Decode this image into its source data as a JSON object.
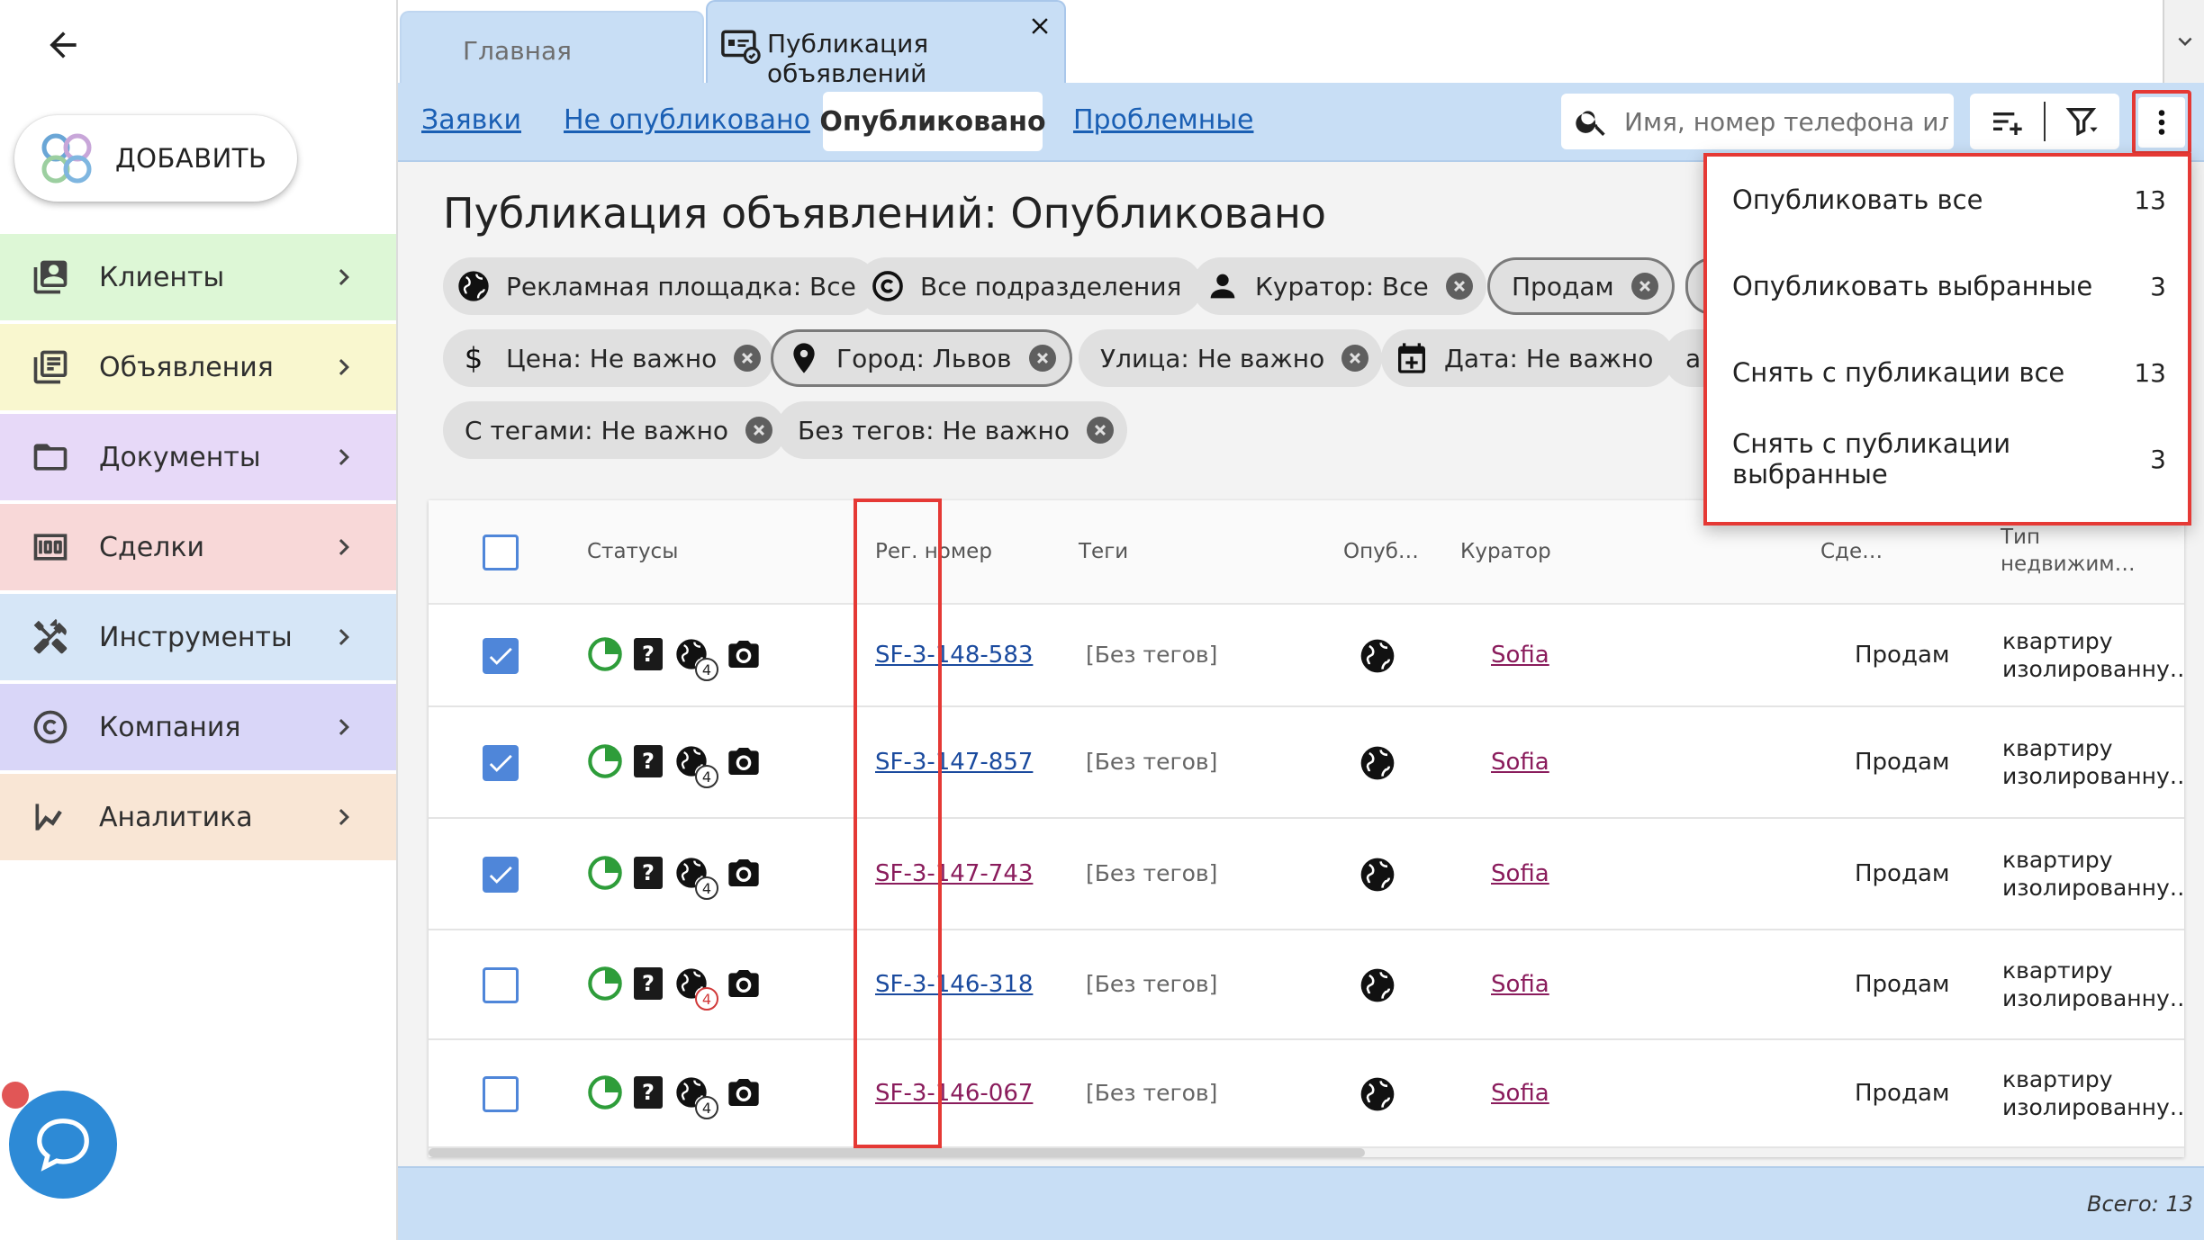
{
  "sidebar": {
    "add_label": "ДОБАВИТЬ",
    "items": [
      {
        "label": "Клиенты",
        "color": "#ddf7d6"
      },
      {
        "label": "Объявления",
        "color": "#f9f7cf"
      },
      {
        "label": "Документы",
        "color": "#e7d9f8"
      },
      {
        "label": "Сделки",
        "color": "#f8d8d8"
      },
      {
        "label": "Инструменты",
        "color": "#d6e6f7"
      },
      {
        "label": "Компания",
        "color": "#d9d6f8"
      },
      {
        "label": "Аналитика",
        "color": "#f9e6d5"
      }
    ]
  },
  "tabs": {
    "home": "Главная",
    "active": "Публикация объявлений"
  },
  "subnav": {
    "requests": "Заявки",
    "not_published": "Не опубликовано",
    "published": "Опубликовано",
    "problematic": "Проблемные"
  },
  "search": {
    "placeholder": "Имя, номер телефона или id"
  },
  "page_title": "Публикация объявлений: Опубликовано",
  "filters": {
    "platform": "Рекламная площадка: Все",
    "divisions": "Все подразделения",
    "curator": "Куратор: Все",
    "sell": "Продам",
    "price": "Цена: Не важно",
    "city": "Город: Львов",
    "street": "Улица: Не важно",
    "date": "Дата: Не важно",
    "partial": "a",
    "with_tags": "С тегами: Не важно",
    "without_tags": "Без тегов: Не важно"
  },
  "table": {
    "headers": {
      "statuses": "Статусы",
      "reg_number": "Рег. номер",
      "tags": "Теги",
      "published": "Опуб…",
      "curator": "Куратор",
      "deal": "Сде…",
      "type_line1": "Тип",
      "type_line2": "недвижим…"
    },
    "rows": [
      {
        "checked": true,
        "reg": "SF-3-148-583",
        "tags": "[Без тегов]",
        "curator": "Sofia",
        "deal": "Продам",
        "type1": "квартиру",
        "type2": "изолированну…",
        "badge": "4",
        "badge_red": false,
        "reg_color": "blue"
      },
      {
        "checked": true,
        "reg": "SF-3-147-857",
        "tags": "[Без тегов]",
        "curator": "Sofia",
        "deal": "Продам",
        "type1": "квартиру",
        "type2": "изолированну…",
        "badge": "4",
        "badge_red": false,
        "reg_color": "blue"
      },
      {
        "checked": true,
        "reg": "SF-3-147-743",
        "tags": "[Без тегов]",
        "curator": "Sofia",
        "deal": "Продам",
        "type1": "квартиру",
        "type2": "изолированну…",
        "badge": "4",
        "badge_red": false,
        "reg_color": "purple"
      },
      {
        "checked": false,
        "reg": "SF-3-146-318",
        "tags": "[Без тегов]",
        "curator": "Sofia",
        "deal": "Продам",
        "type1": "квартиру",
        "type2": "изолированну…",
        "badge": "4",
        "badge_red": true,
        "reg_color": "blue"
      },
      {
        "checked": false,
        "reg": "SF-3-146-067",
        "tags": "[Без тегов]",
        "curator": "Sofia",
        "deal": "Продам",
        "type1": "квартиру",
        "type2": "изолированну…",
        "badge": "4",
        "badge_red": false,
        "reg_color": "purple"
      }
    ]
  },
  "menu": {
    "items": [
      {
        "label": "Опубликовать все",
        "count": "13"
      },
      {
        "label": "Опубликовать выбранные",
        "count": "3"
      },
      {
        "label": "Снять с публикации все",
        "count": "13"
      },
      {
        "label": "Снять с публикации выбранные",
        "count": "3"
      }
    ]
  },
  "footer": {
    "total": "Всего: 13"
  },
  "colors": {
    "accent": "#4f86d9",
    "highlight": "#e53935",
    "subbar": "#c8def5",
    "status_green": "#2e9d3a"
  }
}
